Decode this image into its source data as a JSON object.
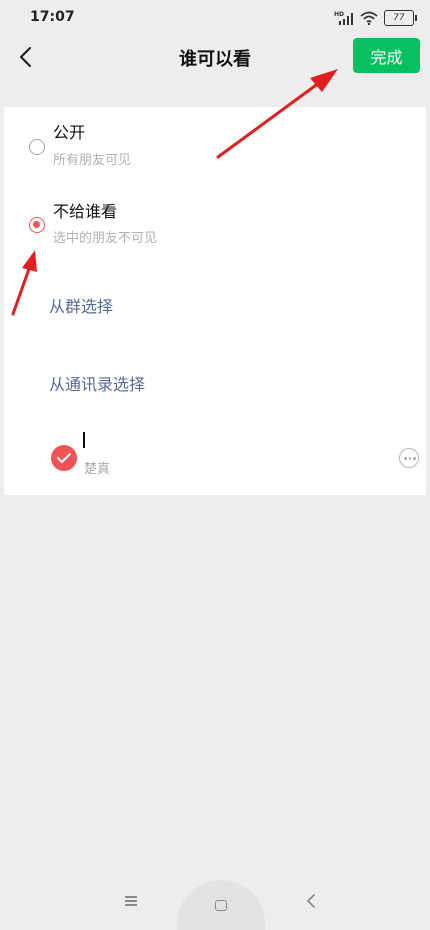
{
  "status_bar": {
    "time": "17:07",
    "network_label": "HD",
    "battery": "77"
  },
  "header": {
    "title": "谁可以看",
    "done_label": "完成"
  },
  "options": [
    {
      "title": "公开",
      "subtitle": "所有朋友可见",
      "selected": false
    },
    {
      "title": "不给谁看",
      "subtitle": "选中的朋友不可见",
      "selected": true
    }
  ],
  "select_links": {
    "from_group": "从群选择",
    "from_contacts": "从通讯录选择"
  },
  "selected_contact": {
    "name": "楚真",
    "checked": true
  },
  "colors": {
    "accent_green": "#07c160",
    "selected_red": "#fa5151",
    "link_blue": "#576b95",
    "annotation_arrow": "#e02020"
  },
  "icons": {
    "back": "chevron-left-icon",
    "more": "more-circle-icon",
    "check": "checkmark-icon",
    "nav_menu": "menu-icon",
    "nav_home": "home-square-icon",
    "nav_back": "nav-back-icon"
  }
}
